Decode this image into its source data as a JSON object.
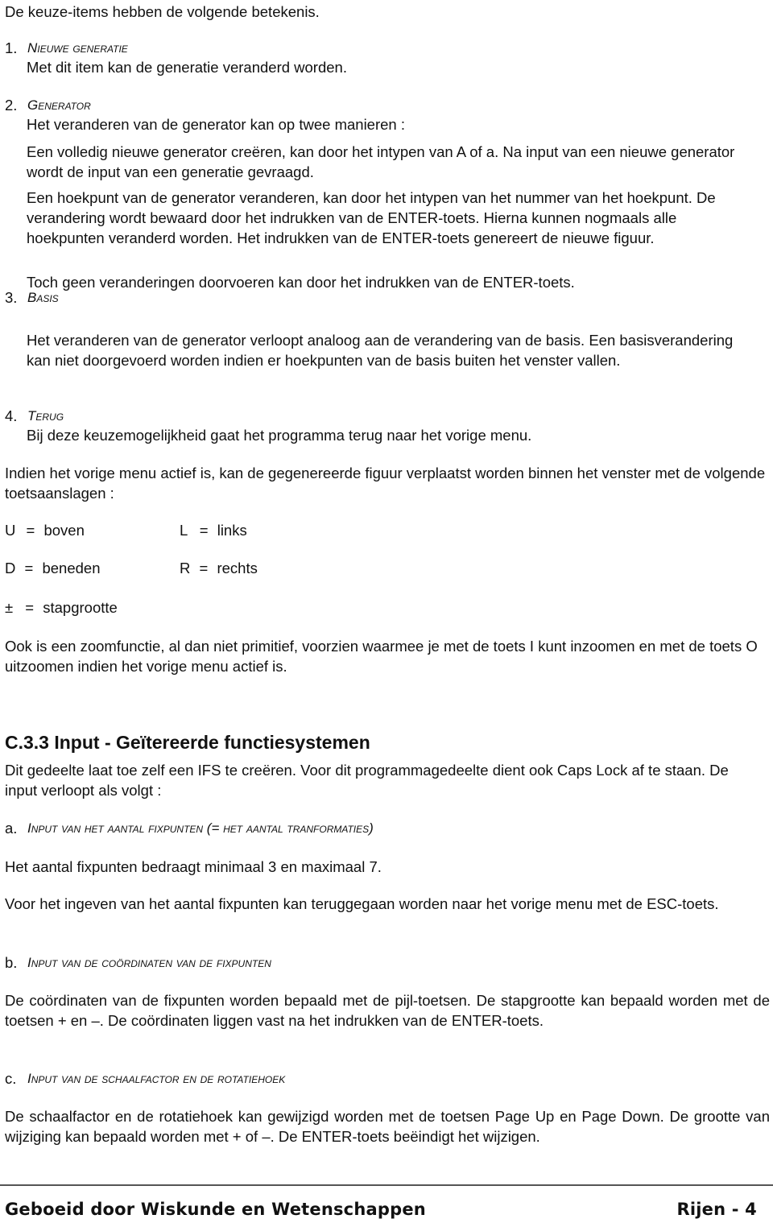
{
  "intro": "De keuze-items hebben de volgende betekenis.",
  "items": [
    {
      "number": "1.",
      "title": "Nieuwe generatie",
      "paragraphs": [
        "Met dit item kan de generatie veranderd worden."
      ]
    },
    {
      "number": "2.",
      "title": "Generator",
      "paragraphs": [
        "Het veranderen van de generator kan op twee manieren :",
        "Een volledig nieuwe generator creëren, kan door het intypen van A of a. Na input van  een nieuwe generator wordt de input van een generatie gevraagd.",
        "Een hoekpunt van de generator veranderen, kan door het intypen van het nummer van het hoekpunt.  De verandering wordt bewaard door het indrukken van de ENTER-toets. Hierna kunnen nogmaals alle hoekpunten veranderd worden. Het indrukken van de ENTER-toets genereert de nieuwe figuur.",
        "Toch geen veranderingen doorvoeren kan door het indrukken van de  ENTER-toets."
      ]
    },
    {
      "number": "3.",
      "title": "Basis",
      "paragraphs": [
        "Het veranderen van de generator verloopt analoog aan de verandering van de basis.  Een basisverandering kan niet doorgevoerd worden indien er hoekpunten van de basis buiten het venster vallen."
      ]
    },
    {
      "number": "4.",
      "title": "Terug",
      "paragraphs": [
        "Bij deze keuzemogelijkheid gaat het programma terug naar het vorige menu."
      ]
    }
  ],
  "move_intro": "Indien het vorige menu actief is, kan de gegenereerde figuur verplaatst worden binnen het venster met de volgende toetsaanslagen :",
  "keys": [
    {
      "key": "U",
      "eq": "=",
      "meaning": "boven"
    },
    {
      "key": "L",
      "eq": "=",
      "meaning": "links"
    },
    {
      "key": "D",
      "eq": "=",
      "meaning": "beneden"
    },
    {
      "key": "R",
      "eq": "=",
      "meaning": "rechts"
    },
    {
      "key": "±",
      "eq": "=",
      "meaning": "stapgrootte"
    }
  ],
  "zoom_text": "Ook is een zoomfunctie, al dan niet primitief, voorzien waarmee je met de toets I kunt inzoomen en met de toets O uitzoomen indien het vorige menu actief is.",
  "section": {
    "heading": "C.3.3  Input - Geïtereerde functiesystemen",
    "intro": "Dit gedeelte laat toe zelf een IFS te creëren.  Voor dit programmagedeelte dient ook Caps Lock af te staan.   De input verloopt als volgt :",
    "subsections": [
      {
        "letter": "a.",
        "title": "Input van het aantal fixpunten (= het aantal tranformaties)",
        "paragraphs": [
          "Het aantal fixpunten bedraagt minimaal 3 en maximaal 7.",
          "Voor het ingeven van het aantal fixpunten kan teruggegaan worden naar het vorige menu met  de ESC-toets."
        ]
      },
      {
        "letter": "b.",
        "title": "Input van de coördinaten van de fixpunten",
        "paragraphs": [
          "De coördinaten van de fixpunten worden bepaald met de pijl-toetsen.  De stapgrootte kan bepaald worden met de toetsen + en –.  De coördinaten liggen vast na het indrukken van de ENTER-toets."
        ]
      },
      {
        "letter": "c.",
        "title": "Input van de schaalfactor en de rotatiehoek",
        "paragraphs": [
          "De schaalfactor en de rotatiehoek kan gewijzigd worden met de toetsen Page Up en Page Down.  De grootte van wijziging kan bepaald worden met + of –.  De ENTER-toets beëindigt het wijzigen."
        ]
      }
    ]
  },
  "footer": {
    "left": "Geboeid door Wiskunde en Wetenschappen",
    "right": "Rijen - 4"
  }
}
